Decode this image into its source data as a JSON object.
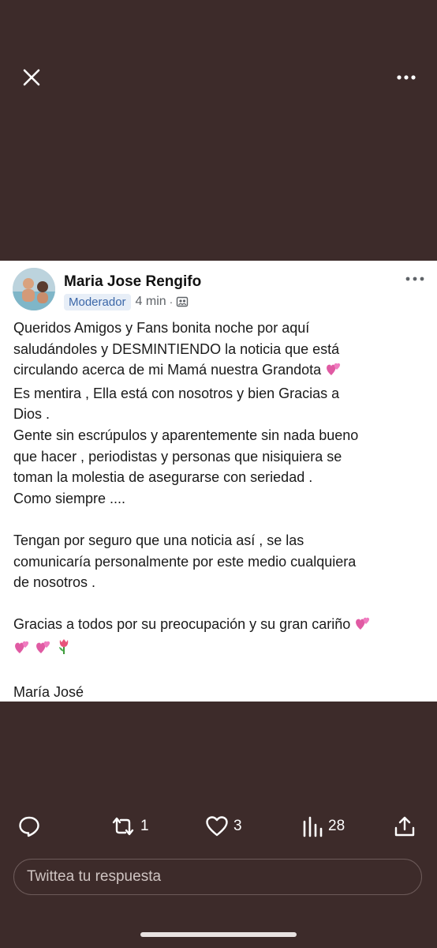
{
  "post": {
    "author": "Maria Jose Rengifo",
    "badge": "Moderador",
    "time": "4 min",
    "separator": "·",
    "lines": [
      "Queridos Amigos y Fans bonita noche por aquí",
      "saludándoles y DESMINTIENDO la noticia que está",
      "circulando acerca de mi Mamá nuestra Grandota",
      "Es mentira , Ella está con nosotros y bien Gracias a",
      "Dios .",
      "Gente sin escrúpulos y aparentemente sin nada bueno",
      "que hacer , periodistas y personas que nisiquiera se",
      "toman la molestia de asegurarse con seriedad .",
      "Como siempre ....",
      "Tengan por seguro que una noticia así , se las",
      "comunicaría personalmente por este medio cualquiera",
      "de nosotros .",
      "Gracias a todos por su preocupación y su gran cariño",
      "María José"
    ]
  },
  "actions": {
    "retweets": "1",
    "likes": "3",
    "views": "28"
  },
  "reply": {
    "placeholder": "Twittea tu respuesta"
  },
  "icons": {
    "close": "close-icon",
    "more": "more-icon",
    "emoji_heart": "two-hearts-emoji",
    "emoji_flower": "tulip-emoji"
  },
  "colors": {
    "background": "#3d2b2a",
    "card": "#ffffff",
    "badge_text": "#3b67a8",
    "badge_bg": "#e7eef7"
  }
}
